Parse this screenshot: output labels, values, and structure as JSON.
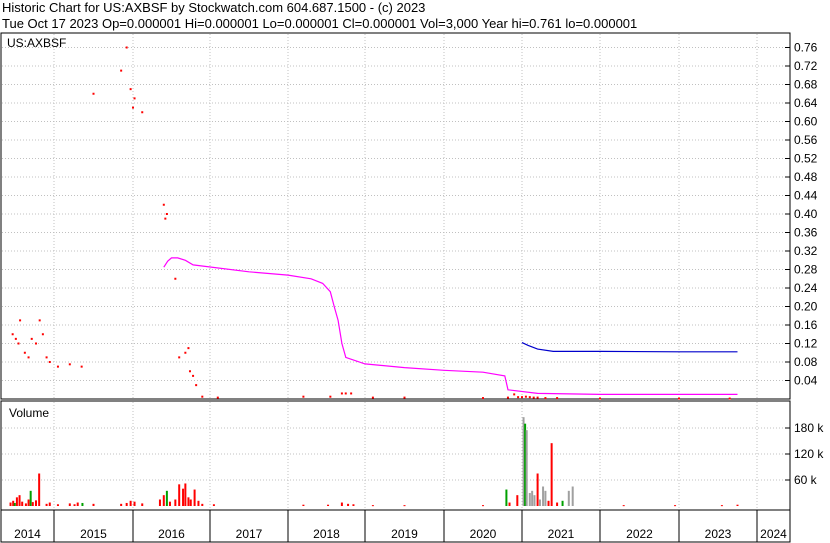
{
  "header": {
    "line1": "Historic Chart for US:AXBSF by Stockwatch.com 604.687.1500 - (c) 2023",
    "line2": "Tue Oct 17 2023   Op=0.000001   Hi=0.000001   Lo=0.000001   Cl=0.000001   Vol=3,000   Year hi=0.761   lo=0.000001"
  },
  "chart_data": [
    {
      "type": "scatter",
      "title": "US:AXBSF",
      "ylim": [
        0,
        0.78
      ],
      "y_ticks": [
        "0.76",
        "0.72",
        "0.68",
        "0.64",
        "0.60",
        "0.56",
        "0.52",
        "0.48",
        "0.44",
        "0.40",
        "0.36",
        "0.32",
        "0.28",
        "0.24",
        "0.20",
        "0.16",
        "0.12",
        "0.08",
        "0.04"
      ],
      "y_tick_values": [
        0.76,
        0.72,
        0.68,
        0.64,
        0.6,
        0.56,
        0.52,
        0.48,
        0.44,
        0.4,
        0.36,
        0.32,
        0.28,
        0.24,
        0.2,
        0.16,
        0.12,
        0.08,
        0.04
      ],
      "xlim": [
        2014.0,
        2024.0
      ],
      "grid": true,
      "price_points": [
        {
          "x": 2014.22,
          "y": 0.14
        },
        {
          "x": 2014.28,
          "y": 0.13
        },
        {
          "x": 2014.33,
          "y": 0.12
        },
        {
          "x": 2014.36,
          "y": 0.17
        },
        {
          "x": 2014.45,
          "y": 0.1
        },
        {
          "x": 2014.52,
          "y": 0.09
        },
        {
          "x": 2014.58,
          "y": 0.13
        },
        {
          "x": 2014.66,
          "y": 0.12
        },
        {
          "x": 2014.73,
          "y": 0.17
        },
        {
          "x": 2014.79,
          "y": 0.14
        },
        {
          "x": 2014.86,
          "y": 0.09
        },
        {
          "x": 2014.92,
          "y": 0.08
        },
        {
          "x": 2015.05,
          "y": 0.07
        },
        {
          "x": 2015.2,
          "y": 0.075
        },
        {
          "x": 2015.35,
          "y": 0.07
        },
        {
          "x": 2015.5,
          "y": 0.66
        },
        {
          "x": 2015.85,
          "y": 0.71
        },
        {
          "x": 2015.92,
          "y": 0.76
        },
        {
          "x": 2015.97,
          "y": 0.67
        },
        {
          "x": 2016.0,
          "y": 0.63
        },
        {
          "x": 2016.02,
          "y": 0.65
        },
        {
          "x": 2016.12,
          "y": 0.62
        },
        {
          "x": 2016.4,
          "y": 0.42
        },
        {
          "x": 2016.42,
          "y": 0.39
        },
        {
          "x": 2016.44,
          "y": 0.4
        },
        {
          "x": 2016.55,
          "y": 0.26
        },
        {
          "x": 2016.6,
          "y": 0.09
        },
        {
          "x": 2016.68,
          "y": 0.1
        },
        {
          "x": 2016.72,
          "y": 0.11
        },
        {
          "x": 2016.74,
          "y": 0.06
        },
        {
          "x": 2016.78,
          "y": 0.05
        },
        {
          "x": 2016.82,
          "y": 0.03
        },
        {
          "x": 2016.9,
          "y": 0.005
        },
        {
          "x": 2017.1,
          "y": 0.003
        },
        {
          "x": 2018.2,
          "y": 0.005
        },
        {
          "x": 2018.55,
          "y": 0.005
        },
        {
          "x": 2018.7,
          "y": 0.012
        },
        {
          "x": 2018.75,
          "y": 0.012
        },
        {
          "x": 2018.82,
          "y": 0.012
        },
        {
          "x": 2019.1,
          "y": 0.003
        },
        {
          "x": 2019.5,
          "y": 0.003
        },
        {
          "x": 2020.5,
          "y": 0.002
        },
        {
          "x": 2020.82,
          "y": 0.003
        },
        {
          "x": 2020.9,
          "y": 0.01
        },
        {
          "x": 2020.95,
          "y": 0.004
        },
        {
          "x": 2021.0,
          "y": 0.004
        },
        {
          "x": 2021.05,
          "y": 0.005
        },
        {
          "x": 2021.1,
          "y": 0.004
        },
        {
          "x": 2021.15,
          "y": 0.003
        },
        {
          "x": 2021.2,
          "y": 0.003
        },
        {
          "x": 2021.3,
          "y": 0.002
        },
        {
          "x": 2021.45,
          "y": 0.002
        },
        {
          "x": 2022.0,
          "y": 0.001
        },
        {
          "x": 2023.0,
          "y": 0.001
        },
        {
          "x": 2023.65,
          "y": 0.001
        }
      ],
      "series": [
        {
          "color": "#ff00ff",
          "x": [
            2016.4,
            2016.45,
            2016.5,
            2016.58,
            2016.68,
            2016.78,
            2017.5,
            2018.0,
            2018.3,
            2018.45,
            2018.55,
            2018.6,
            2018.65,
            2018.7,
            2018.75,
            2019.0,
            2019.5,
            2020.0,
            2020.5,
            2020.78,
            2020.82,
            2021.2,
            2022.0,
            2023.0,
            2023.75
          ],
          "y": [
            0.285,
            0.298,
            0.305,
            0.305,
            0.3,
            0.29,
            0.275,
            0.268,
            0.26,
            0.25,
            0.232,
            0.2,
            0.17,
            0.12,
            0.09,
            0.076,
            0.068,
            0.062,
            0.058,
            0.05,
            0.02,
            0.012,
            0.01,
            0.01,
            0.01
          ]
        },
        {
          "color": "#0000cc",
          "x": [
            2021.0,
            2021.08,
            2021.2,
            2021.4,
            2022.0,
            2023.0,
            2023.75
          ],
          "y": [
            0.122,
            0.116,
            0.108,
            0.103,
            0.103,
            0.102,
            0.102
          ]
        }
      ]
    },
    {
      "type": "bar",
      "title": "Volume",
      "ylim": [
        0,
        220000
      ],
      "y_ticks": [
        "180 k",
        "120 k",
        "60 k"
      ],
      "y_tick_values": [
        180000,
        120000,
        60000
      ],
      "bars": [
        {
          "x": 2014.18,
          "v": 8000,
          "c": "#ff0000"
        },
        {
          "x": 2014.23,
          "v": 12000,
          "c": "#ff0000"
        },
        {
          "x": 2014.26,
          "v": 7000,
          "c": "#00a000"
        },
        {
          "x": 2014.3,
          "v": 20000,
          "c": "#ff0000"
        },
        {
          "x": 2014.35,
          "v": 25000,
          "c": "#ff0000"
        },
        {
          "x": 2014.4,
          "v": 10000,
          "c": "#ff0000"
        },
        {
          "x": 2014.47,
          "v": 6000,
          "c": "#ff0000"
        },
        {
          "x": 2014.52,
          "v": 15000,
          "c": "#ff0000"
        },
        {
          "x": 2014.56,
          "v": 35000,
          "c": "#00a000"
        },
        {
          "x": 2014.6,
          "v": 9000,
          "c": "#ff0000"
        },
        {
          "x": 2014.66,
          "v": 13000,
          "c": "#ff0000"
        },
        {
          "x": 2014.72,
          "v": 75000,
          "c": "#ff0000"
        },
        {
          "x": 2014.86,
          "v": 5000,
          "c": "#ff0000"
        },
        {
          "x": 2014.92,
          "v": 8000,
          "c": "#ff0000"
        },
        {
          "x": 2015.05,
          "v": 4000,
          "c": "#ff0000"
        },
        {
          "x": 2015.2,
          "v": 6000,
          "c": "#ff0000"
        },
        {
          "x": 2015.26,
          "v": 4000,
          "c": "#ff0000"
        },
        {
          "x": 2015.3,
          "v": 8000,
          "c": "#ff0000"
        },
        {
          "x": 2015.36,
          "v": 7000,
          "c": "#00a000"
        },
        {
          "x": 2015.5,
          "v": 5000,
          "c": "#ff0000"
        },
        {
          "x": 2015.85,
          "v": 5000,
          "c": "#ff0000"
        },
        {
          "x": 2015.92,
          "v": 7000,
          "c": "#ff0000"
        },
        {
          "x": 2015.97,
          "v": 12000,
          "c": "#ff0000"
        },
        {
          "x": 2016.02,
          "v": 10000,
          "c": "#ff0000"
        },
        {
          "x": 2016.12,
          "v": 6000,
          "c": "#ff0000"
        },
        {
          "x": 2016.35,
          "v": 15000,
          "c": "#ff0000"
        },
        {
          "x": 2016.4,
          "v": 25000,
          "c": "#ff0000"
        },
        {
          "x": 2016.44,
          "v": 35000,
          "c": "#00a000"
        },
        {
          "x": 2016.48,
          "v": 10000,
          "c": "#ff0000"
        },
        {
          "x": 2016.55,
          "v": 15000,
          "c": "#ff0000"
        },
        {
          "x": 2016.6,
          "v": 50000,
          "c": "#ff0000"
        },
        {
          "x": 2016.65,
          "v": 40000,
          "c": "#ff0000"
        },
        {
          "x": 2016.68,
          "v": 52000,
          "c": "#ff0000"
        },
        {
          "x": 2016.72,
          "v": 20000,
          "c": "#ff0000"
        },
        {
          "x": 2016.75,
          "v": 15000,
          "c": "#ff0000"
        },
        {
          "x": 2016.8,
          "v": 38000,
          "c": "#ff0000"
        },
        {
          "x": 2016.85,
          "v": 12000,
          "c": "#ff0000"
        },
        {
          "x": 2016.9,
          "v": 5000,
          "c": "#ff0000"
        },
        {
          "x": 2017.05,
          "v": 4000,
          "c": "#ff0000"
        },
        {
          "x": 2018.2,
          "v": 3000,
          "c": "#ff0000"
        },
        {
          "x": 2018.52,
          "v": 3000,
          "c": "#ff0000"
        },
        {
          "x": 2018.7,
          "v": 8000,
          "c": "#ff0000"
        },
        {
          "x": 2018.78,
          "v": 5000,
          "c": "#ff0000"
        },
        {
          "x": 2018.85,
          "v": 4000,
          "c": "#ff0000"
        },
        {
          "x": 2019.1,
          "v": 2000,
          "c": "#ff0000"
        },
        {
          "x": 2019.5,
          "v": 2000,
          "c": "#ff0000"
        },
        {
          "x": 2020.5,
          "v": 2000,
          "c": "#ff0000"
        },
        {
          "x": 2020.8,
          "v": 38000,
          "c": "#00a000"
        },
        {
          "x": 2020.84,
          "v": 8000,
          "c": "#ff0000"
        },
        {
          "x": 2020.94,
          "v": 25000,
          "c": "#ff0000"
        },
        {
          "x": 2021.02,
          "v": 205000,
          "c": "#a0a0a0"
        },
        {
          "x": 2021.04,
          "v": 190000,
          "c": "#00a000"
        },
        {
          "x": 2021.06,
          "v": 175000,
          "c": "#a0a0a0"
        },
        {
          "x": 2021.1,
          "v": 30000,
          "c": "#a0a0a0"
        },
        {
          "x": 2021.13,
          "v": 35000,
          "c": "#a0a0a0"
        },
        {
          "x": 2021.16,
          "v": 25000,
          "c": "#a0a0a0"
        },
        {
          "x": 2021.2,
          "v": 75000,
          "c": "#ff0000"
        },
        {
          "x": 2021.23,
          "v": 15000,
          "c": "#a0a0a0"
        },
        {
          "x": 2021.27,
          "v": 45000,
          "c": "#a0a0a0"
        },
        {
          "x": 2021.3,
          "v": 35000,
          "c": "#a0a0a0"
        },
        {
          "x": 2021.34,
          "v": 12000,
          "c": "#ff0000"
        },
        {
          "x": 2021.38,
          "v": 145000,
          "c": "#ff0000"
        },
        {
          "x": 2021.45,
          "v": 8000,
          "c": "#ff0000"
        },
        {
          "x": 2021.52,
          "v": 12000,
          "c": "#00a000"
        },
        {
          "x": 2021.6,
          "v": 35000,
          "c": "#a0a0a0"
        },
        {
          "x": 2021.65,
          "v": 45000,
          "c": "#a0a0a0"
        },
        {
          "x": 2022.3,
          "v": 2000,
          "c": "#ff0000"
        },
        {
          "x": 2022.95,
          "v": 2000,
          "c": "#ff0000"
        },
        {
          "x": 2023.55,
          "v": 2000,
          "c": "#ff0000"
        },
        {
          "x": 2023.75,
          "v": 3000,
          "c": "#ff0000"
        }
      ]
    }
  ],
  "x_axis": {
    "years": [
      "2014",
      "2015",
      "2016",
      "2017",
      "2018",
      "2019",
      "2020",
      "2021",
      "2022",
      "2023",
      "2024"
    ]
  },
  "colors": {
    "up": "#00a000",
    "down": "#ff0000",
    "grid": "#c0c0c0",
    "ma_long": "#ff00ff",
    "ma_short": "#0000cc"
  }
}
